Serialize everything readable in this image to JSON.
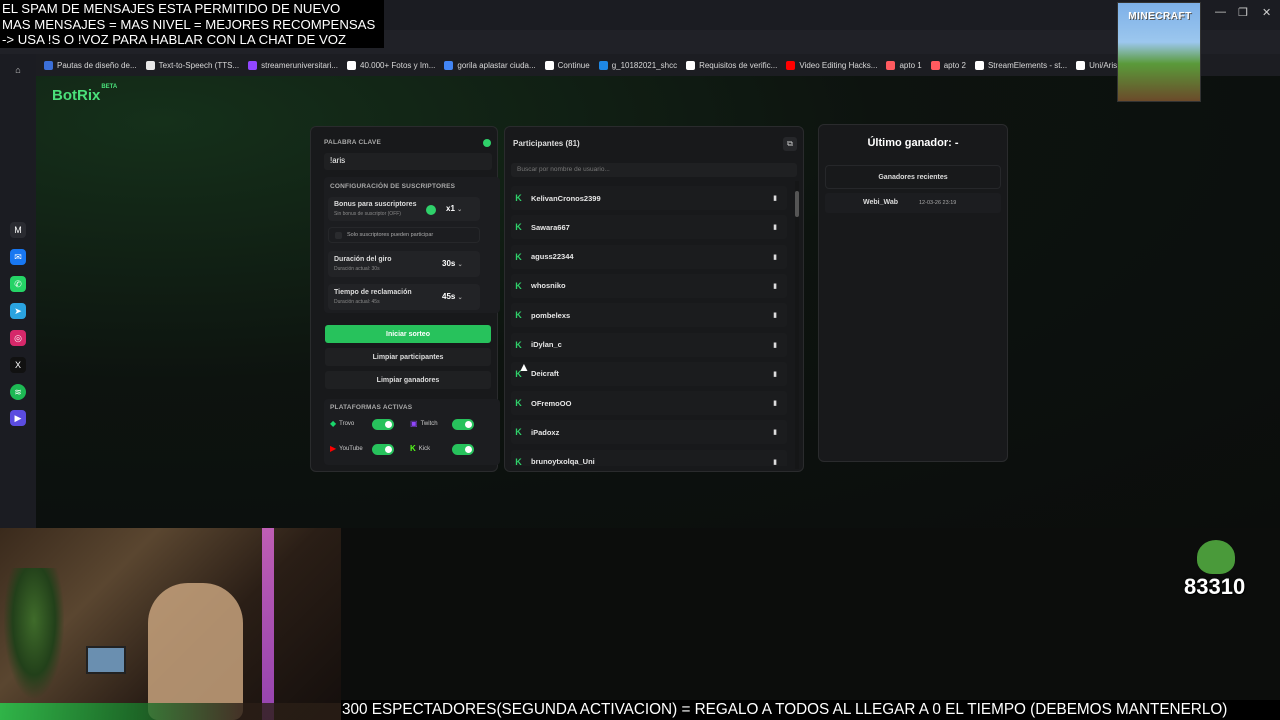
{
  "overlay": {
    "line1": "EL SPAM DE MENSAJES ESTA PERMITIDO DE NUEVO",
    "line2": "MAS MENSAJES = MAS NIVEL = MEJORES RECOMPENSAS",
    "line3": "-> USA !S O !VOZ PARA HABLAR CON LA CHAT DE VOZ"
  },
  "minecraft_label": "MINECRAFT",
  "bookmarks": [
    {
      "label": "Pautas de diseño de...",
      "color": "#3b6fd8"
    },
    {
      "label": "Text-to-Speech (TTS...",
      "color": "#e8e8e8"
    },
    {
      "label": "streameruniversitari...",
      "color": "#9146ff"
    },
    {
      "label": "40.000+ Fotos y Im...",
      "color": "#ffffff"
    },
    {
      "label": "gorila aplastar ciuda...",
      "color": "#4285f4"
    },
    {
      "label": "Continue",
      "color": "#ffffff"
    },
    {
      "label": "g_10182021_shcc",
      "color": "#1e88e5"
    },
    {
      "label": "Requisitos de verific...",
      "color": "#ffffff"
    },
    {
      "label": "Video Editing Hacks...",
      "color": "#ff0000"
    },
    {
      "label": "apto 1",
      "color": "#ff5a5f"
    },
    {
      "label": "apto 2",
      "color": "#ff5a5f"
    },
    {
      "label": "StreamElements - st...",
      "color": "#ffffff"
    },
    {
      "label": "Uni/Aris",
      "color": "#ffffff"
    }
  ],
  "app": {
    "logo": "BotRix",
    "logo_badge": "BETA"
  },
  "keyword": {
    "label": "PALABRA CLAVE",
    "value": "!aris"
  },
  "subs": {
    "header": "CONFIGURACIÓN DE SUSCRIPTORES",
    "bonus_title": "Bonus para suscriptores",
    "bonus_sub": "Sin bonus de suscriptor (OFF)",
    "bonus_value": "x1",
    "only_subs": "Solo suscriptores pueden participar"
  },
  "spin": {
    "title": "Duración del giro",
    "sub": "Duración actual: 30s",
    "value": "30s"
  },
  "claim": {
    "title": "Tiempo de reclamación",
    "sub": "Duración actual: 45s",
    "value": "45s"
  },
  "buttons": {
    "start": "Iniciar sorteo",
    "clear_participants": "Limpiar participantes",
    "clear_winners": "Limpiar ganadores"
  },
  "platforms": {
    "header": "PLATAFORMAS ACTIVAS",
    "items": [
      {
        "name": "Trovo",
        "color": "#19d66b",
        "active": true
      },
      {
        "name": "Twitch",
        "color": "#9146ff",
        "active": true
      },
      {
        "name": "YouTube",
        "color": "#ff0000",
        "active": true
      },
      {
        "name": "Kick",
        "color": "#53fc18",
        "active": true
      }
    ]
  },
  "participants": {
    "header": "Participantes (81)",
    "search_placeholder": "Buscar por nombre de usuario...",
    "list": [
      "KelivanCronos2399",
      "Sawara667",
      "aguss22344",
      "whosniko",
      "pombelexs",
      "iDylan_c",
      "Deicraft",
      "OFremoOO",
      "iPadoxz",
      "brunoytxolqa_Uni"
    ]
  },
  "winner": {
    "title": "Último ganador: -",
    "recent_header": "Ganadores recientes",
    "recent": [
      {
        "name": "Webi_Wab",
        "date": "12-03-26 23:19"
      }
    ]
  },
  "pepe_count": "83310",
  "ticker": "300 ESPECTADORES(SEGUNDA ACTIVACION) = REGALO A TODOS AL LLEGAR A 0 EL TIEMPO (DEBEMOS MANTENERLO)"
}
